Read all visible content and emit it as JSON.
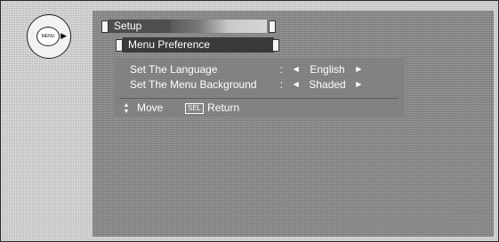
{
  "remote": {
    "dial_label": "MENU",
    "dial_arrow_icon": "play-right-icon"
  },
  "menu": {
    "title": "Setup",
    "submenu_title": "Menu Preference",
    "options": [
      {
        "label": "Set The Language",
        "separator": ":",
        "value": "English"
      },
      {
        "label": "Set The Menu Background",
        "separator": ":",
        "value": "Shaded"
      }
    ],
    "hints": {
      "move_label": "Move",
      "return_key": "SEL",
      "return_label": "Return"
    }
  },
  "colors": {
    "screen_bg": "#9a9a9a",
    "tab_dark": "#3a3a3a",
    "text": "#ffffff"
  }
}
